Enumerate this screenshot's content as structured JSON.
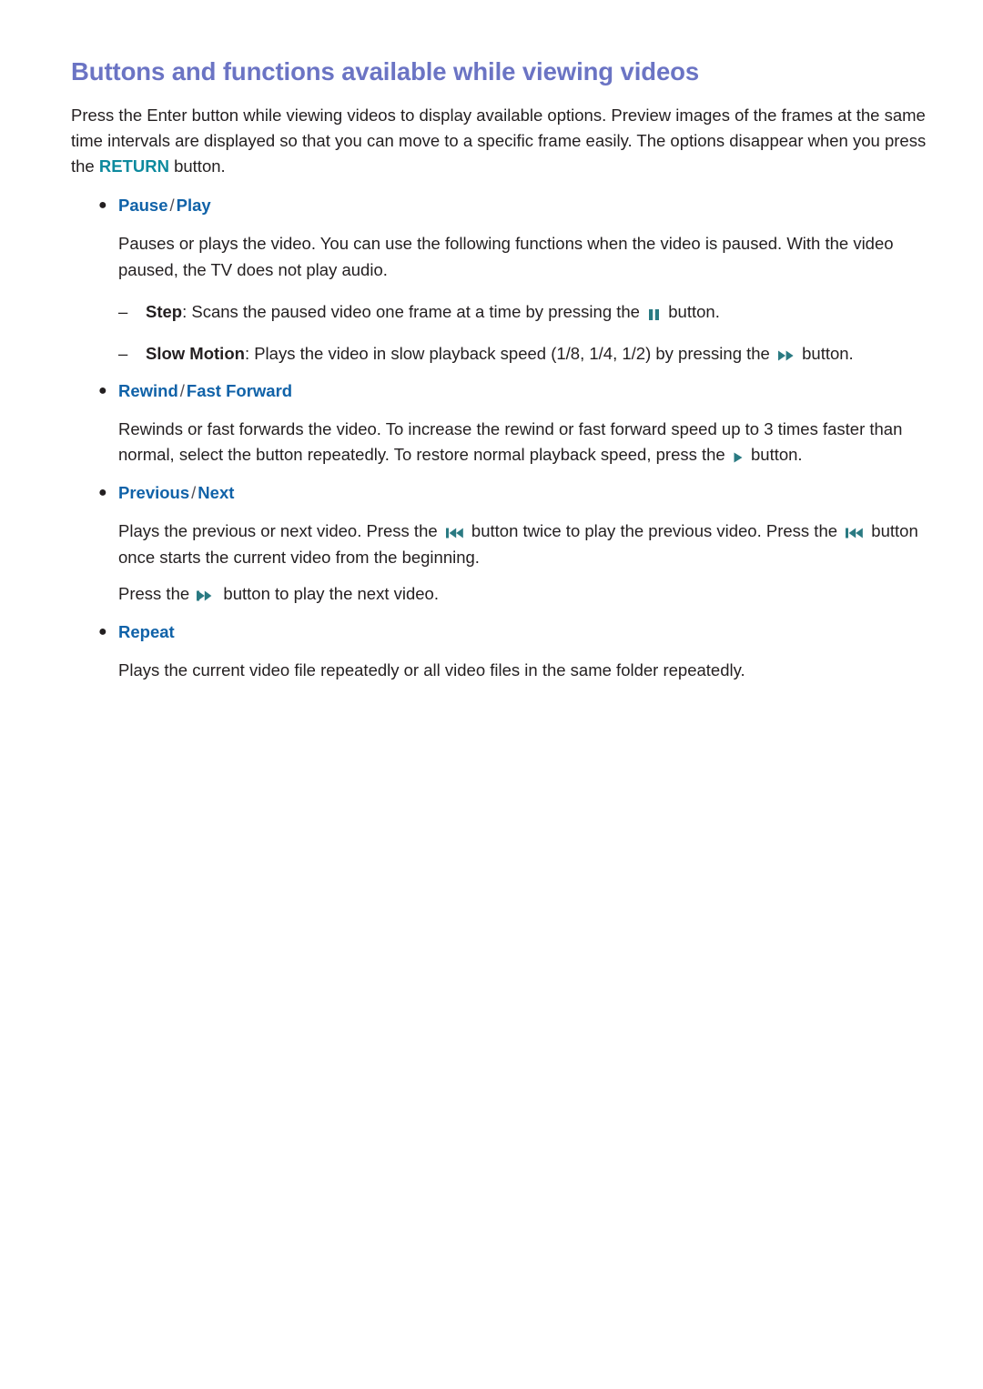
{
  "colors": {
    "title": "#6b74c4",
    "bullet_label": "#1062a8",
    "keyword": "#0d8a9e",
    "icon": "#2a7a82",
    "body_text": "#231f20"
  },
  "title": "Buttons and functions available while viewing videos",
  "intro": {
    "before_keyword": "Press the Enter button while viewing videos to display available options. Preview images of the frames at the same time intervals are displayed so that you can move to a specific frame easily. The options disappear when you press the ",
    "keyword": "RETURN",
    "after_keyword": " button."
  },
  "bullet_marker": "●",
  "dash_marker": "–",
  "sections": [
    {
      "label_primary": "Pause",
      "label_separator": "/",
      "label_secondary": "Play",
      "paragraph": "Pauses or plays the video. You can use the following functions when the video is paused. With the video paused, the TV does not play audio.",
      "subitems": [
        {
          "term": "Step",
          "term_suffix": ":",
          "text_before_icon": " Scans the paused video one frame at a time by pressing the ",
          "icon": "pause-icon",
          "text_after_icon": " button."
        },
        {
          "term": "Slow Motion",
          "term_suffix": ":",
          "text_before_icon": " Plays the video in slow playback speed (1/8, 1/4, 1/2) by pressing the ",
          "icon": "fast-forward-icon",
          "text_after_icon": " button."
        }
      ]
    },
    {
      "label_primary": "Rewind",
      "label_separator": "/",
      "label_secondary": "Fast Forward",
      "paragraph_before_icon": "Rewinds or fast forwards the video. To increase the rewind or fast forward speed up to 3 times faster than normal, select the button repeatedly. To restore normal playback speed, press the ",
      "icon": "play-icon",
      "paragraph_after_icon": " button."
    },
    {
      "label_primary": "Previous",
      "label_separator": "/",
      "label_secondary": "Next",
      "paragraph_1": {
        "part_1": "Plays the previous or next video. Press the ",
        "icon_1": "previous-icon",
        "part_2": " button twice to play the previous video. Press the ",
        "icon_2": "previous-icon",
        "part_3": " button once starts the current video from the beginning."
      },
      "paragraph_2": {
        "part_1": "Press the ",
        "icon_1": "next-icon",
        "part_2": " button to play the next video."
      }
    },
    {
      "label_primary": "Repeat",
      "paragraph": "Plays the current video file repeatedly or all video files in the same folder repeatedly."
    }
  ]
}
